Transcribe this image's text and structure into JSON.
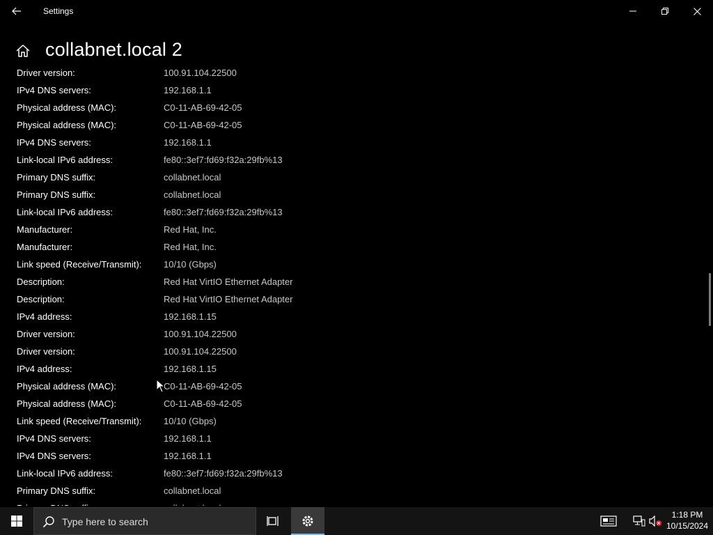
{
  "window": {
    "title": "Settings"
  },
  "page": {
    "title": "collabnet.local 2"
  },
  "properties": [
    {
      "label": "Driver version:",
      "value": "100.91.104.22500"
    },
    {
      "label": "IPv4 DNS servers:",
      "value": "192.168.1.1"
    },
    {
      "label": "Physical address (MAC):",
      "value": "C0-11-AB-69-42-05"
    },
    {
      "label": "Physical address (MAC):",
      "value": "C0-11-AB-69-42-05"
    },
    {
      "label": "IPv4 DNS servers:",
      "value": "192.168.1.1"
    },
    {
      "label": "Link-local IPv6 address:",
      "value": "fe80::3ef7:fd69:f32a:29fb%13"
    },
    {
      "label": "Primary DNS suffix:",
      "value": "collabnet.local"
    },
    {
      "label": "Primary DNS suffix:",
      "value": "collabnet.local"
    },
    {
      "label": "Link-local IPv6 address:",
      "value": "fe80::3ef7:fd69:f32a:29fb%13"
    },
    {
      "label": "Manufacturer:",
      "value": "Red Hat, Inc."
    },
    {
      "label": "Manufacturer:",
      "value": "Red Hat, Inc."
    },
    {
      "label": "Link speed (Receive/Transmit):",
      "value": "10/10 (Gbps)"
    },
    {
      "label": "Description:",
      "value": "Red Hat VirtIO Ethernet Adapter"
    },
    {
      "label": "Description:",
      "value": "Red Hat VirtIO Ethernet Adapter"
    },
    {
      "label": "IPv4 address:",
      "value": "192.168.1.15"
    },
    {
      "label": "Driver version:",
      "value": "100.91.104.22500"
    },
    {
      "label": "Driver version:",
      "value": "100.91.104.22500"
    },
    {
      "label": "IPv4 address:",
      "value": "192.168.1.15"
    },
    {
      "label": "Physical address (MAC):",
      "value": "C0-11-AB-69-42-05"
    },
    {
      "label": "Physical address (MAC):",
      "value": "C0-11-AB-69-42-05"
    },
    {
      "label": "Link speed (Receive/Transmit):",
      "value": "10/10 (Gbps)"
    },
    {
      "label": "IPv4 DNS servers:",
      "value": "192.168.1.1"
    },
    {
      "label": "IPv4 DNS servers:",
      "value": "192.168.1.1"
    },
    {
      "label": "Link-local IPv6 address:",
      "value": "fe80::3ef7:fd69:f32a:29fb%13"
    },
    {
      "label": "Primary DNS suffix:",
      "value": "collabnet.local"
    },
    {
      "label": "Primary DNS suffix:",
      "value": "collabnet.local"
    }
  ],
  "taskbar": {
    "search_placeholder": "Type here to search",
    "clock": {
      "time": "1:18 PM",
      "date": "10/15/2024"
    }
  },
  "colors": {
    "background": "#000000",
    "taskbar": "#141414",
    "accent": "#76b9ed"
  },
  "icons": {
    "back": "back-arrow-icon",
    "home": "home-icon",
    "minimize": "minimize-icon",
    "maximize": "restore-icon",
    "close": "close-icon",
    "start": "windows-logo-icon",
    "search": "search-icon",
    "taskview": "task-view-icon",
    "settings": "gear-icon",
    "news": "news-icon",
    "network": "network-icon",
    "volume": "volume-muted-icon"
  }
}
